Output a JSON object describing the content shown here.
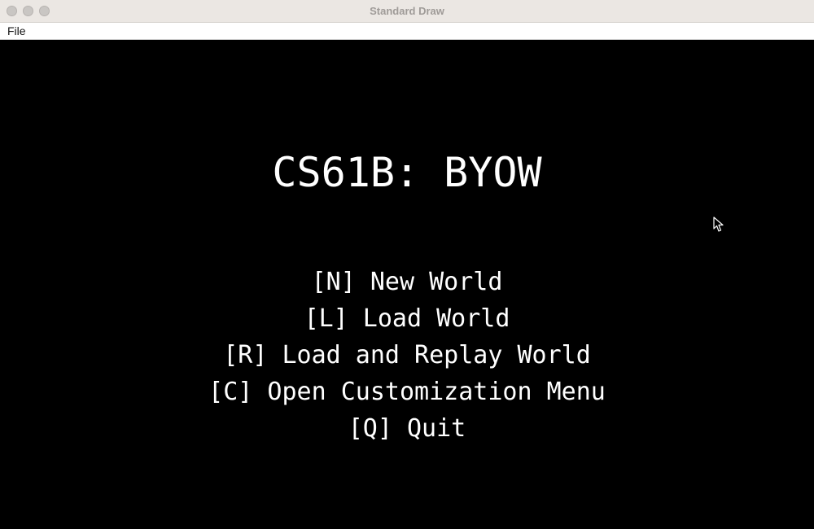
{
  "window": {
    "title": "Standard Draw"
  },
  "menubar": {
    "file_label": "File"
  },
  "screen": {
    "title": "CS61B: BYOW",
    "options": [
      "[N] New World",
      "[L] Load World",
      "[R] Load and Replay World",
      "[C] Open Customization Menu",
      "[Q] Quit"
    ]
  },
  "colors": {
    "background": "#000000",
    "text": "#ffffff",
    "titlebar": "#ebe7e3"
  },
  "icons": {
    "cursor": "arrow-cursor-icon"
  }
}
